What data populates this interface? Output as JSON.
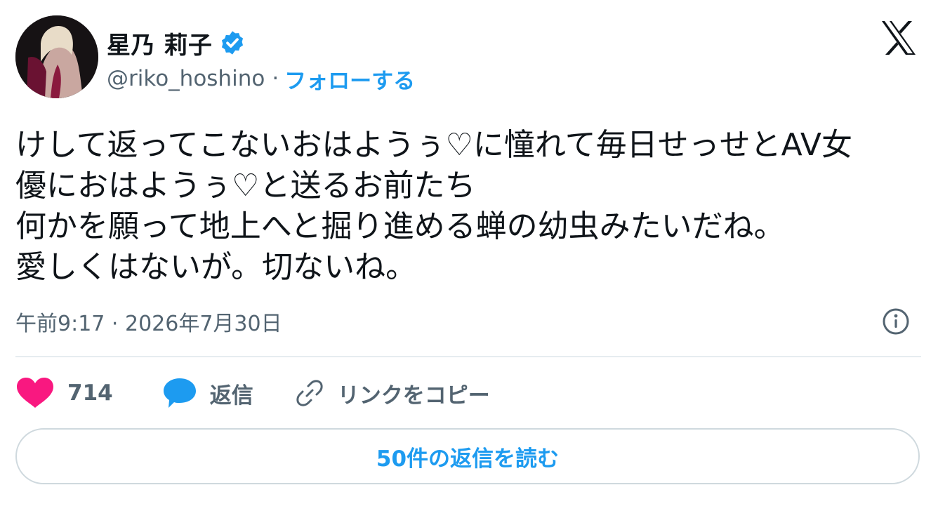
{
  "header": {
    "display_name": "星乃 莉子",
    "handle": "@riko_hoshino",
    "separator": "·",
    "follow_label": "フォローする"
  },
  "tweet": {
    "lines": [
      "けして返ってこないおはようぅ♡に憧れて毎日せっせとAV女",
      "優におはようぅ♡と送るお前たち",
      "何かを願って地上へと掘り進める蝉の幼虫みたいだね。",
      "愛しくはないが。切ないね。"
    ],
    "timestamp": "午前9:17 · 2026年7月30日"
  },
  "actions": {
    "like_count": "714",
    "reply_label": "返信",
    "copy_link_label": "リンクをコピー"
  },
  "read_replies_label": "50件の返信を読む",
  "colors": {
    "accent": "#1d9bf0",
    "like": "#f91880",
    "muted": "#536471",
    "text": "#0f1419",
    "border": "#cfd9de"
  },
  "icons": [
    "verified-badge-icon",
    "x-logo-icon",
    "info-icon",
    "heart-icon",
    "reply-bubble-icon",
    "link-icon"
  ]
}
